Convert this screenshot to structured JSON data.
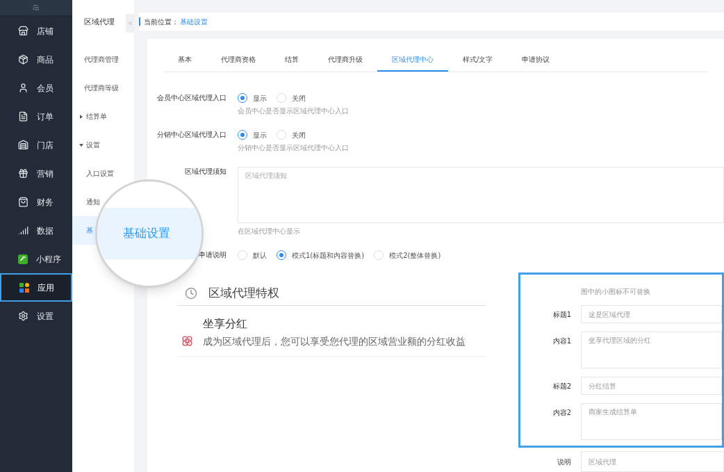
{
  "sidebar": {
    "items": [
      {
        "label": "店铺",
        "selected": false
      },
      {
        "label": "商品",
        "selected": false
      },
      {
        "label": "会员",
        "selected": false
      },
      {
        "label": "订单",
        "selected": false
      },
      {
        "label": "门店",
        "selected": false
      },
      {
        "label": "营销",
        "selected": false
      },
      {
        "label": "财务",
        "selected": false
      },
      {
        "label": "数据",
        "selected": false
      },
      {
        "label": "小程序",
        "selected": false
      },
      {
        "label": "应用",
        "selected": true
      },
      {
        "label": "设置",
        "selected": false
      }
    ]
  },
  "subnav": {
    "title": "区域代理",
    "items": [
      {
        "label": "代理商管理",
        "selected": false
      },
      {
        "label": "代理商等级",
        "selected": false
      },
      {
        "label": "结算单",
        "selected": false,
        "expanded": false
      },
      {
        "label": "设置",
        "selected": false,
        "expanded": true,
        "children": [
          {
            "label": "入口设置",
            "selected": false
          },
          {
            "label": "通知",
            "selected": false
          },
          {
            "label": "基",
            "selected": true
          }
        ]
      }
    ]
  },
  "magnifier": {
    "text": "基础设置"
  },
  "breadcrumb": {
    "label": "当前位置：",
    "current": "基础设置"
  },
  "tabs": [
    {
      "label": "基本",
      "selected": false
    },
    {
      "label": "代理商资格",
      "selected": false
    },
    {
      "label": "结算",
      "selected": false
    },
    {
      "label": "代理商升级",
      "selected": false
    },
    {
      "label": "区域代理中心",
      "selected": true
    },
    {
      "label": "样式/文字",
      "selected": false
    },
    {
      "label": "申请协议",
      "selected": false
    }
  ],
  "form": [
    {
      "kind": "radio",
      "label": "会员中心区域代理入口",
      "options": [
        {
          "label": "显示",
          "selected": true
        },
        {
          "label": "关闭",
          "selected": false
        }
      ],
      "hint": "会员中心是否显示区域代理中心入口"
    },
    {
      "kind": "radio",
      "label": "分销中心区域代理入口",
      "options": [
        {
          "label": "显示",
          "selected": true
        },
        {
          "label": "关闭",
          "selected": false
        }
      ],
      "hint": "分销中心是否显示区域代理中心入口"
    },
    {
      "kind": "textarea",
      "label": "区域代理须知",
      "placeholder": "区域代理须知",
      "hint": "在区域代理中心显示"
    },
    {
      "kind": "radio",
      "label": "申请说明",
      "options": [
        {
          "label": "默认",
          "selected": false
        },
        {
          "label": "模式1(标题和内容替换)",
          "selected": true
        },
        {
          "label": "模式2(整体替换)",
          "selected": false
        }
      ]
    }
  ],
  "preview": {
    "title": "区域代理特权",
    "item_title": "坐享分红",
    "item_text": "成为区域代理后，您可以享受您代理的区域营业额的分红收益"
  },
  "custom": {
    "note": "图中的小图标不可替换",
    "fields": [
      {
        "kind": "input",
        "label": "标题1",
        "placeholder": "这是区域代理"
      },
      {
        "kind": "textarea",
        "label": "内容1",
        "placeholder": "坐享代理区域的分红"
      },
      {
        "kind": "input",
        "label": "标题2",
        "placeholder": "分红结算"
      },
      {
        "kind": "textarea",
        "label": "内容2",
        "placeholder": "商家生成结算单"
      }
    ]
  },
  "extra_field": {
    "kind": "input",
    "label": "说明",
    "placeholder": "区域代理"
  }
}
